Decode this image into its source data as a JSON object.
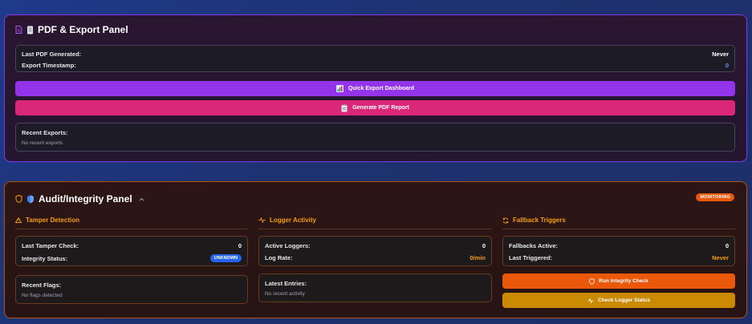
{
  "pdf_panel": {
    "title": "PDF & Export Panel",
    "status": {
      "last_pdf_label": "Last PDF Generated:",
      "last_pdf_value": "Never",
      "export_ts_label": "Export Timestamp:",
      "export_ts_value": "0"
    },
    "quick_export_label": "Quick Export Dashboard",
    "generate_pdf_label": "Generate PDF Report",
    "recent_exports": {
      "label": "Recent Exports:",
      "empty": "No recent exports"
    }
  },
  "audit_panel": {
    "title": "Audit/Integrity Panel",
    "badge": "MONITORING",
    "tamper": {
      "heading": "Tamper Detection",
      "last_check_label": "Last Tamper Check:",
      "last_check_value": "0",
      "integrity_label": "Integrity Status:",
      "integrity_value": "UNKNOWN",
      "flags_label": "Recent Flags:",
      "flags_empty": "No flags detected"
    },
    "logger": {
      "heading": "Logger Activity",
      "active_label": "Active Loggers:",
      "active_value": "0",
      "rate_label": "Log Rate:",
      "rate_value": "0/min",
      "entries_label": "Latest Entries:",
      "entries_empty": "No recent activity"
    },
    "fallback": {
      "heading": "Fallback Triggers",
      "active_label": "Fallbacks Active:",
      "active_value": "0",
      "last_label": "Last Triggered:",
      "last_value": "Never"
    },
    "run_check_label": "Run Integrity Check",
    "check_logger_label": "Check Logger Status"
  },
  "colors": {
    "purple": "#9333ea",
    "pink": "#db2777",
    "orange": "#ea580c",
    "amber": "#f59e0b",
    "yellow": "#ca8a04",
    "blue": "#2563eb"
  },
  "icons": [
    "document-icon",
    "scroll-icon",
    "chart-icon",
    "clipboard-icon",
    "shield-outline-icon",
    "shield-blue-icon",
    "chevron-up-icon",
    "warning-icon",
    "activity-icon",
    "refresh-icon"
  ]
}
